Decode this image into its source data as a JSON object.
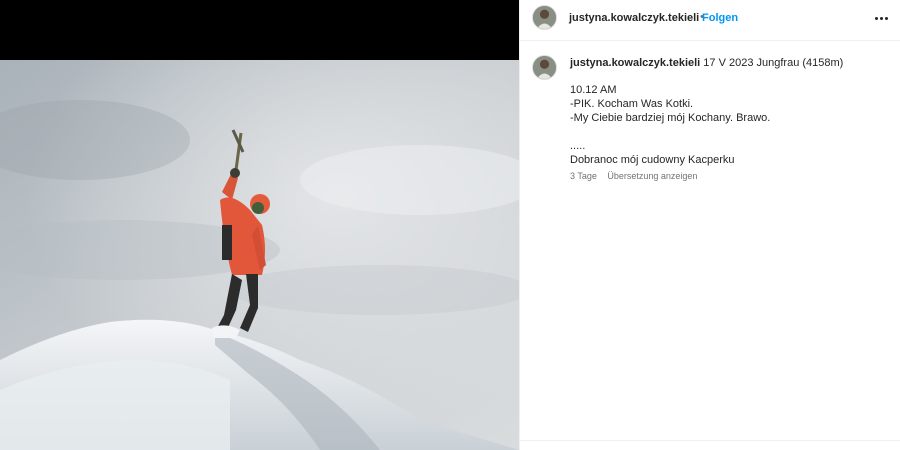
{
  "post": {
    "username": "justyna.kowalczyk.tekieli",
    "follow_label": "Folgen",
    "separator": "•",
    "more_icon": "more-horizontal-icon"
  },
  "caption": {
    "username": "justyna.kowalczyk.tekieli",
    "first_line": "17 V 2023 Jungfrau (4158m)",
    "lines": [
      "10.12 AM",
      "-PIK. Kocham Was Kotki.",
      "-My Ciebie bardziej mój Kochany. Brawo.",
      "",
      ".....",
      "Dobranoc mój cudowny Kacperku"
    ],
    "time_ago": "3 Tage",
    "translate_label": "Übersetzung anzeigen"
  },
  "colors": {
    "link_blue": "#0095f6",
    "jacket": "#e2563a",
    "media_bg": "#000000"
  }
}
